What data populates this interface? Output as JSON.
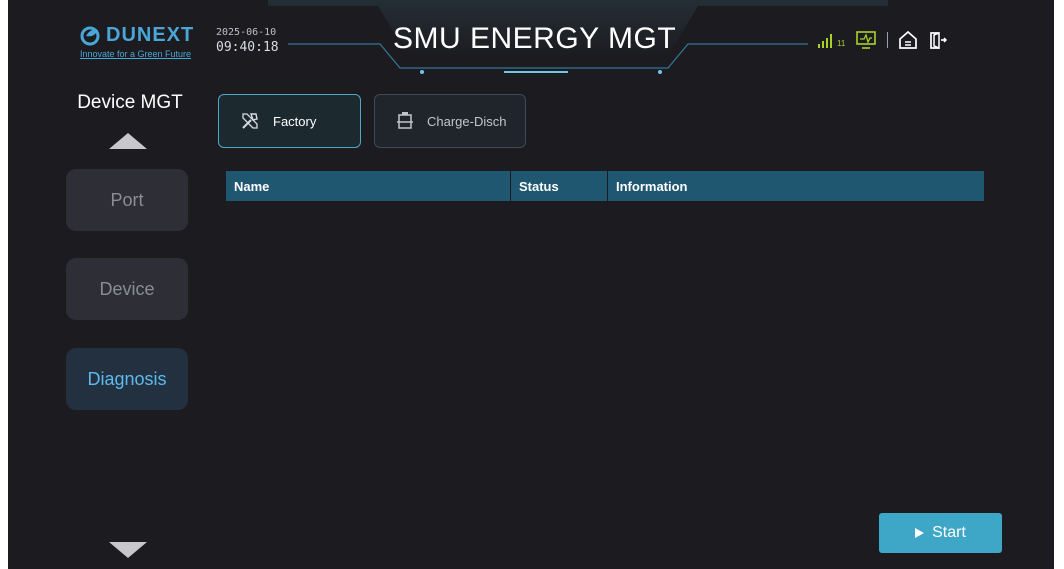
{
  "brand": {
    "name": "DUNEXT",
    "tagline": "Innovate for a Green Future"
  },
  "header": {
    "date": "2025-06-10",
    "time": "09:40:18",
    "title": "SMU ENERGY MGT",
    "icons": [
      "signal-icon",
      "monitor-icon",
      "home-icon",
      "logout-icon"
    ],
    "signal_text": "11"
  },
  "sidebar": {
    "title": "Device MGT",
    "items": [
      {
        "label": "Port",
        "active": false
      },
      {
        "label": "Device",
        "active": false
      },
      {
        "label": "Diagnosis",
        "active": true
      }
    ]
  },
  "tabs": [
    {
      "label": "Factory",
      "icon": "tools-icon",
      "active": true
    },
    {
      "label": "Charge-Disch",
      "icon": "battery-icon",
      "active": false
    }
  ],
  "table": {
    "columns": [
      "Name",
      "Status",
      "Information"
    ],
    "rows": []
  },
  "actions": {
    "start_label": "Start"
  },
  "colors": {
    "background": "#1c1c20",
    "accent": "#3ea6c6",
    "table_header": "#1f5670",
    "nav_active_text": "#5fb9ee",
    "signal": "#a8d22a"
  }
}
